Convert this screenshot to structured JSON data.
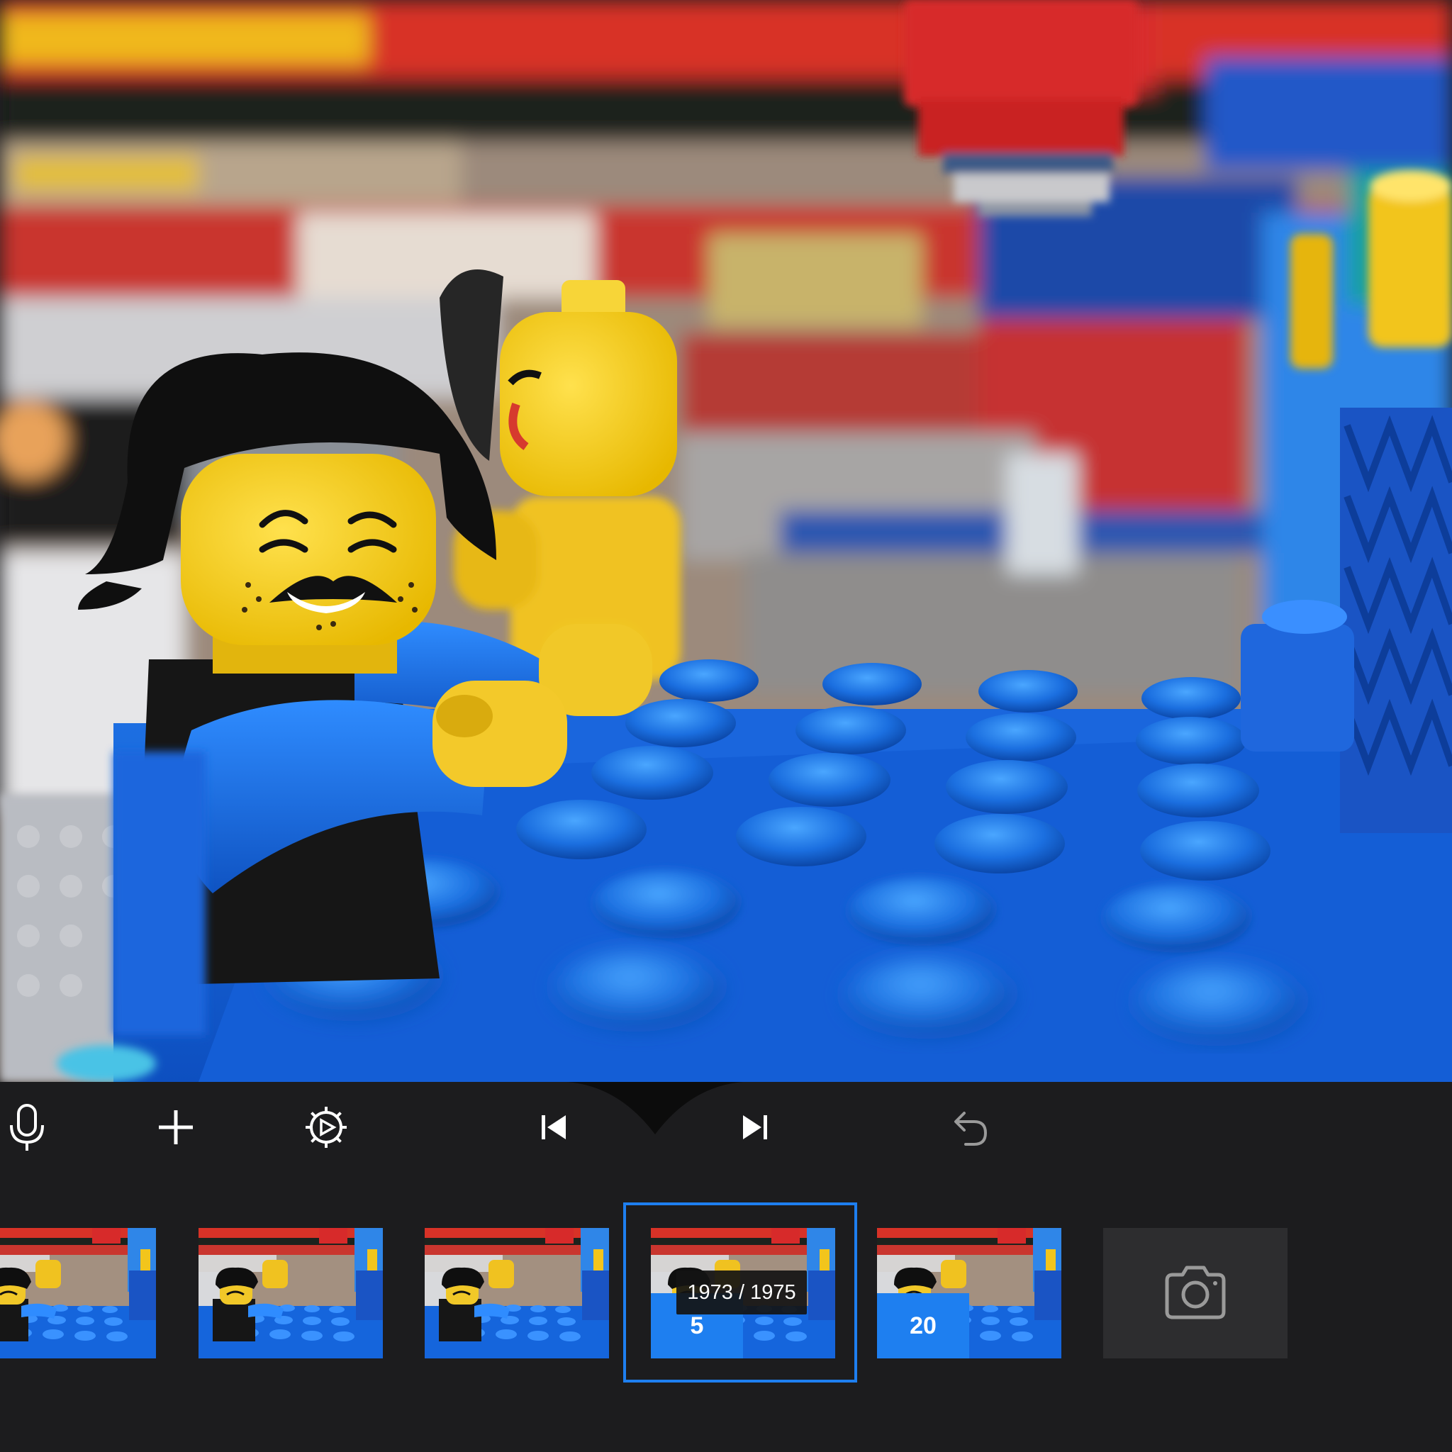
{
  "toolbar": {
    "icons": [
      "microphone-icon",
      "plus-icon",
      "settings-gear-play-icon",
      "skip-back-icon",
      "skip-forward-icon",
      "undo-icon"
    ]
  },
  "filmstrip": {
    "frames": [
      {
        "label": ""
      },
      {
        "label": ""
      },
      {
        "label": ""
      },
      {
        "label": "5"
      },
      {
        "label": "20"
      }
    ],
    "selected_index": 3,
    "frame_counter": "1973 / 1975",
    "capture_icon": "camera-icon"
  },
  "colors": {
    "background": "#1c1c1e",
    "accent_blue": "#1e7ff0",
    "capture_tile": "#2d2d2f",
    "icon_white": "#ffffff",
    "icon_gray": "#9a9a9a"
  }
}
